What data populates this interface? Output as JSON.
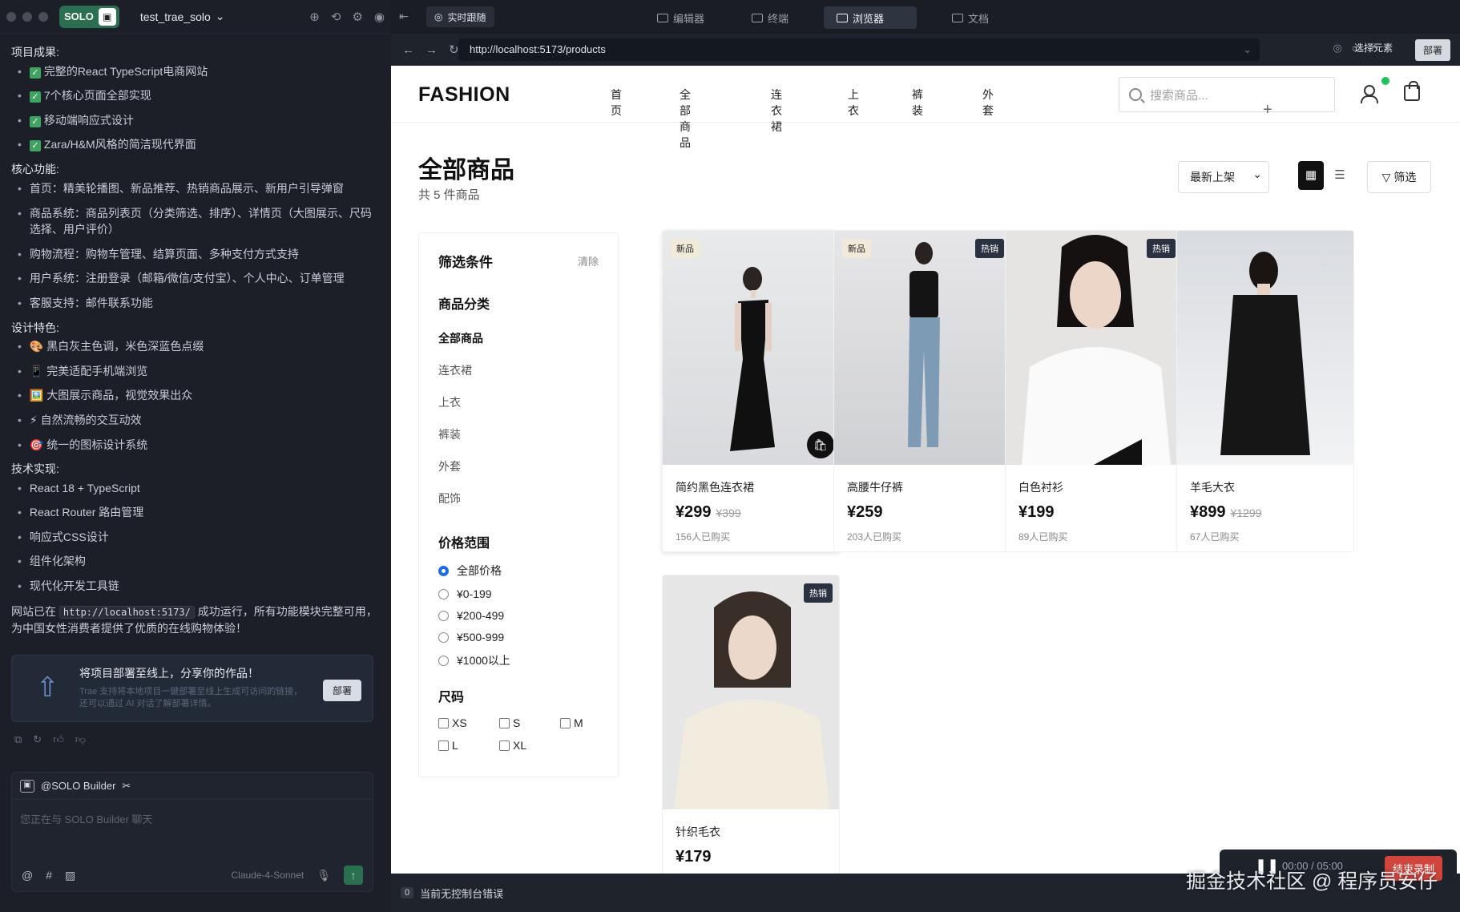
{
  "left": {
    "solo_label": "SOLO",
    "project": "test_trae_solo",
    "sections": [
      {
        "title": "项目成果:",
        "items": [
          "完整的React TypeScript电商网站",
          "7个核心页面全部实现",
          "移动端响应式设计",
          "Zara/H&M风格的简洁现代界面"
        ]
      },
      {
        "title": "核心功能:",
        "items": [
          "首页：精美轮播图、新品推荐、热销商品展示、新用户引导弹窗",
          "商品系统：商品列表页（分类筛选、排序）、详情页（大图展示、尺码选择、用户评价）",
          "购物流程：购物车管理、结算页面、多种支付方式支持",
          "用户系统：注册登录（邮箱/微信/支付宝）、个人中心、订单管理",
          "客服支持：邮件联系功能"
        ]
      },
      {
        "title": "设计特色:",
        "items": [
          "🎨 黑白灰主色调，米色深蓝色点缀",
          "📱 完美适配手机端浏览",
          "🖼️ 大图展示商品，视觉效果出众",
          "⚡ 自然流畅的交互动效",
          "🎯 统一的图标设计系统"
        ]
      },
      {
        "title": "技术实现:",
        "items": [
          "React 18 + TypeScript",
          "React Router 路由管理",
          "响应式CSS设计",
          "组件化架构",
          "现代化开发工具链"
        ]
      }
    ],
    "footer_prefix": "网站已在",
    "footer_code": "http://localhost:5173/",
    "footer_suffix": "成功运行，所有功能模块完整可用，为中国女性消费者提供了优质的在线购物体验！",
    "deploy": {
      "title": "将项目部署至线上，分享你的作品！",
      "desc": "Trae 支持将本地项目一键部署至线上生成可访问的链接，还可以通过 AI 对话了解部署详情。",
      "button": "部署"
    },
    "chat": {
      "agent": "@SOLO Builder",
      "placeholder": "您正在与 SOLO Builder 聊天",
      "model": "Claude-4-Sonnet"
    }
  },
  "tabs": {
    "realtime": "实时跟随",
    "editor": "编辑器",
    "terminal": "终端",
    "browser": "浏览器",
    "docs": "文档"
  },
  "url": "http://localhost:5173/products",
  "urlbar": {
    "select": "选择元素",
    "deploy": "部署"
  },
  "site": {
    "logo": "FASHION",
    "menu": [
      "首页",
      "全部商品",
      "连衣裙",
      "上衣",
      "裤装",
      "外套"
    ],
    "search_placeholder": "搜索商品...",
    "title": "全部商品",
    "count": "共 5 件商品",
    "sort": "最新上架",
    "filter_btn": "筛选",
    "filter": {
      "title": "筛选条件",
      "clear": "清除",
      "category_title": "商品分类",
      "categories": [
        "全部商品",
        "连衣裙",
        "上衣",
        "裤装",
        "外套",
        "配饰"
      ],
      "price_title": "价格范围",
      "prices": [
        "全部价格",
        "¥0-199",
        "¥200-499",
        "¥500-999",
        "¥1000以上"
      ],
      "size_title": "尺码",
      "sizes": [
        "XS",
        "S",
        "M",
        "L",
        "XL"
      ]
    },
    "products": [
      {
        "name": "简约黑色连衣裙",
        "price": "¥299",
        "old": "¥399",
        "sold": "156人已购买",
        "badge": "新品"
      },
      {
        "name": "高腰牛仔裤",
        "price": "¥259",
        "old": "",
        "sold": "203人已购买",
        "badge": "新品",
        "badge2": "热销"
      },
      {
        "name": "白色衬衫",
        "price": "¥199",
        "old": "",
        "sold": "89人已购买",
        "badge": "热销"
      },
      {
        "name": "羊毛大衣",
        "price": "¥899",
        "old": "¥1299",
        "sold": "67人已购买",
        "badge": ""
      },
      {
        "name": "针织毛衣",
        "price": "¥179",
        "old": "",
        "sold": "",
        "badge": "热销"
      }
    ]
  },
  "status": {
    "count": "0",
    "text": "当前无控制台错误"
  },
  "recording": {
    "time": "00:00 / 05:00",
    "end": "结束录制"
  },
  "watermark": "掘金技术社区 @ 程序员安仔"
}
